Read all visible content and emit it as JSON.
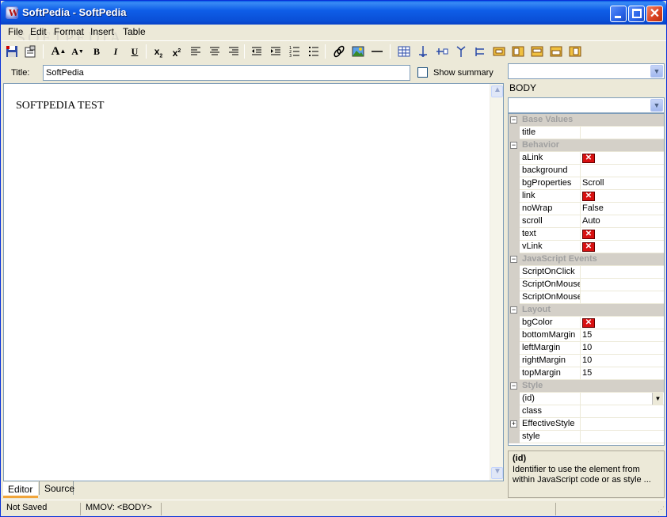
{
  "window": {
    "title": "SoftPedia - SoftPedia"
  },
  "menu": [
    "File",
    "Edit",
    "Format",
    "Insert",
    "Table"
  ],
  "watermark": "SOFTPEDIA",
  "toolbar": {
    "icons": [
      "save-icon",
      "properties-icon",
      "font-grow-icon",
      "font-shrink-icon",
      "bold-icon",
      "italic-icon",
      "underline-icon",
      "subscript-icon",
      "superscript-icon",
      "align-left-icon",
      "align-center-icon",
      "align-right-icon",
      "outdent-icon",
      "indent-icon",
      "ordered-list-icon",
      "unordered-list-icon",
      "link-icon",
      "image-icon",
      "horizontal-rule-icon",
      "table-icon",
      "insert-column-icon",
      "insert-row-icon",
      "merge-cells-icon",
      "split-cells-icon",
      "cell-props-icon",
      "table-props-1-icon",
      "table-props-2-icon",
      "table-props-3-icon",
      "table-props-4-icon"
    ],
    "bold": "B",
    "italic": "I",
    "underline": "U"
  },
  "title_row": {
    "label": "Title:",
    "value": "SoftPedia",
    "show_summary_label": "Show summary",
    "show_summary_checked": false
  },
  "editor": {
    "content": "SOFTPEDIA TEST"
  },
  "tabs": [
    {
      "label": "Editor",
      "active": true
    },
    {
      "label": "Source",
      "active": false
    }
  ],
  "right_panel": {
    "top_dropdown": "",
    "element_label": "BODY",
    "element_dropdown": "",
    "properties": [
      {
        "type": "cat",
        "label": "Base Values"
      },
      {
        "type": "prop",
        "name": "title",
        "value": ""
      },
      {
        "type": "cat",
        "label": "Behavior"
      },
      {
        "type": "prop",
        "name": "aLink",
        "value": "",
        "color_x": true
      },
      {
        "type": "prop",
        "name": "background",
        "value": ""
      },
      {
        "type": "prop",
        "name": "bgProperties",
        "value": "Scroll"
      },
      {
        "type": "prop",
        "name": "link",
        "value": "",
        "color_x": true
      },
      {
        "type": "prop",
        "name": "noWrap",
        "value": "False"
      },
      {
        "type": "prop",
        "name": "scroll",
        "value": "Auto"
      },
      {
        "type": "prop",
        "name": "text",
        "value": "",
        "color_x": true
      },
      {
        "type": "prop",
        "name": "vLink",
        "value": "",
        "color_x": true
      },
      {
        "type": "cat",
        "label": "JavaScript Events"
      },
      {
        "type": "prop",
        "name": "ScriptOnClick",
        "value": ""
      },
      {
        "type": "prop",
        "name": "ScriptOnMouse",
        "value": ""
      },
      {
        "type": "prop",
        "name": "ScriptOnMouse",
        "value": ""
      },
      {
        "type": "cat",
        "label": "Layout"
      },
      {
        "type": "prop",
        "name": "bgColor",
        "value": "",
        "color_x": true
      },
      {
        "type": "prop",
        "name": "bottomMargin",
        "value": "15"
      },
      {
        "type": "prop",
        "name": "leftMargin",
        "value": "10"
      },
      {
        "type": "prop",
        "name": "rightMargin",
        "value": "10"
      },
      {
        "type": "prop",
        "name": "topMargin",
        "value": "15"
      },
      {
        "type": "cat",
        "label": "Style"
      },
      {
        "type": "prop",
        "name": "(id)",
        "value": "",
        "dropdown": true,
        "selected": true
      },
      {
        "type": "prop",
        "name": "class",
        "value": ""
      },
      {
        "type": "prop",
        "name": "EffectiveStyle",
        "value": "",
        "expandable": true
      },
      {
        "type": "prop",
        "name": "style",
        "value": ""
      }
    ],
    "help": {
      "title": "(id)",
      "description": "Identifier to use the element from within JavaScript code or as style ..."
    }
  },
  "status": {
    "saved": "Not Saved",
    "path": "MMOV: <BODY>"
  }
}
